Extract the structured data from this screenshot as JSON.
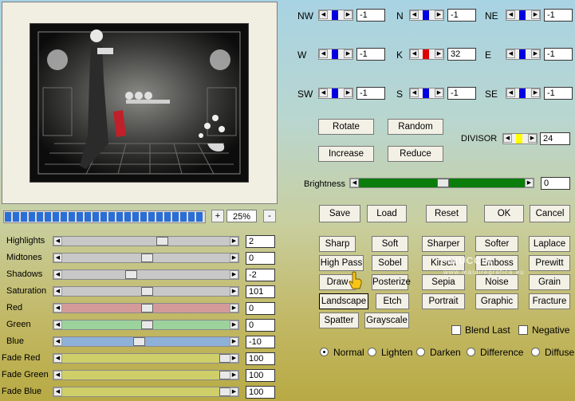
{
  "preview": {
    "zoom_minus": "-",
    "zoom_plus": "+",
    "zoom_value": "25%",
    "progress_fraction": 0.99
  },
  "adjust": [
    {
      "label": "Highlights",
      "value": "2",
      "level": 0.6,
      "color": "#c8c8c8"
    },
    {
      "label": "Midtones",
      "value": "0",
      "level": 0.5,
      "color": "#c8c8c8"
    },
    {
      "label": "Shadows",
      "value": "-2",
      "level": 0.4,
      "color": "#c8c8c8"
    },
    {
      "label": "Saturation",
      "value": "101",
      "level": 0.5,
      "color": "#c8c8c8"
    },
    {
      "label": "Red",
      "value": "0",
      "level": 0.5,
      "color": "#d49a9a"
    },
    {
      "label": "Green",
      "value": "0",
      "level": 0.5,
      "color": "#9cd39c"
    },
    {
      "label": "Blue",
      "value": "-10",
      "level": 0.45,
      "color": "#8fb1d8"
    },
    {
      "label": "Fade Red",
      "value": "100",
      "level": 1.0,
      "color": "#cfcf6a"
    },
    {
      "label": "Fade Green",
      "value": "100",
      "level": 1.0,
      "color": "#cfcf6a"
    },
    {
      "label": "Fade Blue",
      "value": "100",
      "level": 1.0,
      "color": "#cfcf6a"
    }
  ],
  "kernel": [
    {
      "label": "NW",
      "value": "-1",
      "thumb": "#0000e0"
    },
    {
      "label": "N",
      "value": "-1",
      "thumb": "#0000e0"
    },
    {
      "label": "NE",
      "value": "-1",
      "thumb": "#0000e0"
    },
    {
      "label": "W",
      "value": "-1",
      "thumb": "#0000e0"
    },
    {
      "label": "K",
      "value": "32",
      "thumb": "#e00000"
    },
    {
      "label": "E",
      "value": "-1",
      "thumb": "#0000e0"
    },
    {
      "label": "SW",
      "value": "-1",
      "thumb": "#0000e0"
    },
    {
      "label": "S",
      "value": "-1",
      "thumb": "#0000e0"
    },
    {
      "label": "SE",
      "value": "-1",
      "thumb": "#0000e0"
    }
  ],
  "actions": {
    "rotate": "Rotate",
    "random": "Random",
    "increase": "Increase",
    "reduce": "Reduce"
  },
  "divisor": {
    "label": "DIVISOR",
    "value": "24",
    "thumb": "#ffff00"
  },
  "brightness": {
    "label": "Brightness",
    "value": "0",
    "level": 0.5
  },
  "dialog": {
    "save": "Save",
    "load": "Load",
    "reset": "Reset",
    "ok": "OK",
    "cancel": "Cancel"
  },
  "presets": [
    [
      "Sharp",
      "Soft",
      "Sharper",
      "Softer",
      "Laplace"
    ],
    [
      "High Pass",
      "Sobel",
      "Kirsch",
      "Emboss",
      "Prewitt"
    ],
    [
      "Draw",
      "Posterize",
      "Sepia",
      "Noise",
      "Grain"
    ],
    [
      "Landscape",
      "Etch",
      "Portrait",
      "Graphic",
      "Fracture"
    ],
    [
      "Spatter",
      "Grayscale"
    ]
  ],
  "options": {
    "blend_last": "Blend Last",
    "negative": "Negative"
  },
  "modes": [
    {
      "label": "Normal",
      "selected": true
    },
    {
      "label": "Lighten",
      "selected": false
    },
    {
      "label": "Darken",
      "selected": false
    },
    {
      "label": "Difference",
      "selected": false
    },
    {
      "label": "Diffuse",
      "selected": false
    }
  ],
  "watermark": {
    "brand": "PINUCCIA",
    "url": "www.maidiregrafica.eu"
  }
}
